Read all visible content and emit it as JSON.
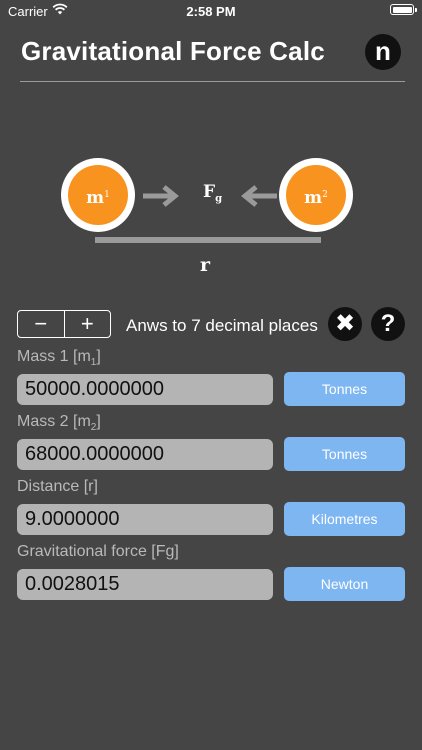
{
  "status_bar": {
    "carrier": "Carrier",
    "time": "2:58 PM"
  },
  "header": {
    "title": "Gravitational Force Calc",
    "logo_letter": "n"
  },
  "diagram": {
    "mass1_symbol": "m",
    "mass1_index": "1",
    "mass2_symbol": "m",
    "mass2_index": "2",
    "force_symbol": "F",
    "force_subscript": "g",
    "distance_symbol": "r"
  },
  "controls": {
    "decrease_label": "−",
    "increase_label": "+",
    "decimal_text": "Anws to 7 decimal places",
    "clear_icon": "✖",
    "help_icon": "?"
  },
  "fields": {
    "mass1": {
      "label": "Mass 1 [m",
      "label_sub": "1",
      "label_end": "]",
      "value": "50000.0000000",
      "unit": "Tonnes"
    },
    "mass2": {
      "label": "Mass 2 [m",
      "label_sub": "2",
      "label_end": "]",
      "value": "68000.0000000",
      "unit": "Tonnes"
    },
    "distance": {
      "label": "Distance [r]",
      "value": "9.0000000",
      "unit": "Kilometres"
    },
    "force": {
      "label": "Gravitational force [Fg]",
      "value": "0.0028015",
      "unit": "Newton"
    }
  },
  "colors": {
    "background": "#454545",
    "mass_orange": "#f7931e",
    "unit_button_blue": "#7eb6f2",
    "value_box_grey": "#b4b4b4"
  }
}
